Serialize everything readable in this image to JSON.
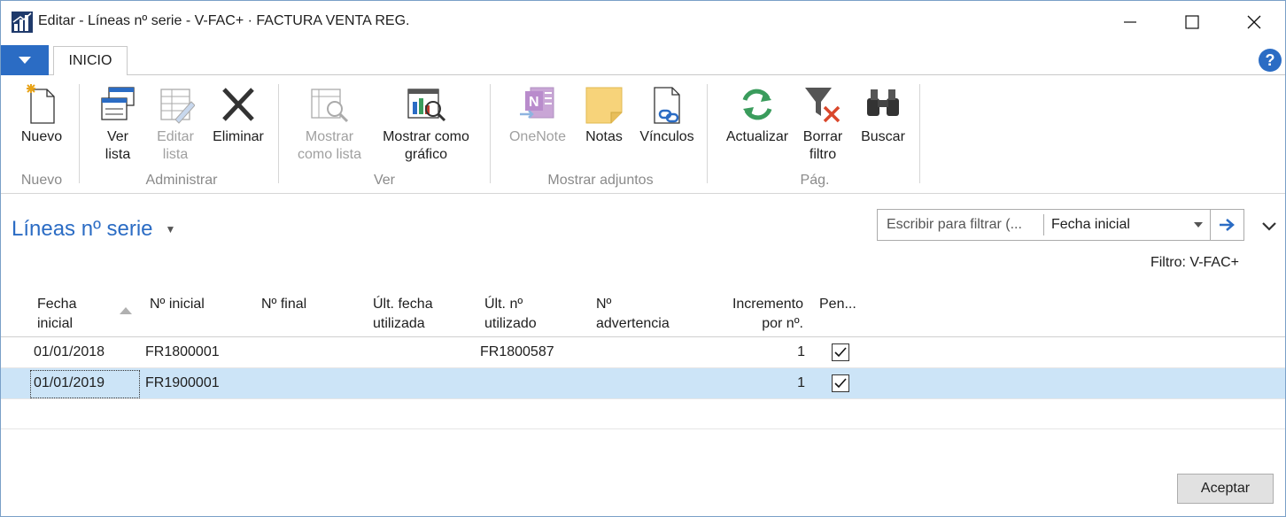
{
  "window": {
    "title": "Editar - Líneas nº serie - V-FAC+ · FACTURA VENTA REG."
  },
  "ribbon": {
    "tab": "INICIO",
    "groups": {
      "nuevo": "Nuevo",
      "administrar": "Administrar",
      "ver": "Ver",
      "adjuntos": "Mostrar adjuntos",
      "pag": "Pág."
    },
    "buttons": {
      "nuevo": "Nuevo",
      "ver_lista_1": "Ver",
      "ver_lista_2": "lista",
      "editar_lista_1": "Editar",
      "editar_lista_2": "lista",
      "eliminar": "Eliminar",
      "mostrar_lista_1": "Mostrar",
      "mostrar_lista_2": "como lista",
      "mostrar_grafico_1": "Mostrar como",
      "mostrar_grafico_2": "gráfico",
      "onenote": "OneNote",
      "notas": "Notas",
      "vinculos": "Vínculos",
      "actualizar": "Actualizar",
      "borrar_filtro_1": "Borrar",
      "borrar_filtro_2": "filtro",
      "buscar": "Buscar"
    }
  },
  "page": {
    "title": "Líneas nº serie",
    "filter": {
      "placeholder": "Escribir para filtrar (...",
      "field": "Fecha inicial"
    },
    "filter_caption": "Filtro: V-FAC+"
  },
  "grid": {
    "headers": {
      "fecha_inicial_1": "Fecha",
      "fecha_inicial_2": "inicial",
      "n_inicial": "Nº inicial",
      "n_final": "Nº final",
      "ult_fecha_1": "Últ. fecha",
      "ult_fecha_2": "utilizada",
      "ult_n_1": "Últ. nº",
      "ult_n_2": "utilizado",
      "n_advertencia_1": "Nº",
      "n_advertencia_2": "advertencia",
      "incremento_1": "Incremento",
      "incremento_2": "por nº.",
      "pendiente": "Pen..."
    },
    "rows": [
      {
        "fecha_inicial": "01/01/2018",
        "n_inicial": "FR1800001",
        "n_final": "",
        "ult_fecha": "",
        "ult_n": "FR1800587",
        "n_advertencia": "",
        "incremento": "1",
        "pendiente": true
      },
      {
        "fecha_inicial": "01/01/2019",
        "n_inicial": "FR1900001",
        "n_final": "",
        "ult_fecha": "",
        "ult_n": "",
        "n_advertencia": "",
        "incremento": "1",
        "pendiente": true
      }
    ]
  },
  "footer": {
    "accept": "Aceptar"
  },
  "colors": {
    "accent": "#2b6cc4",
    "selected_row": "#cce4f7"
  }
}
